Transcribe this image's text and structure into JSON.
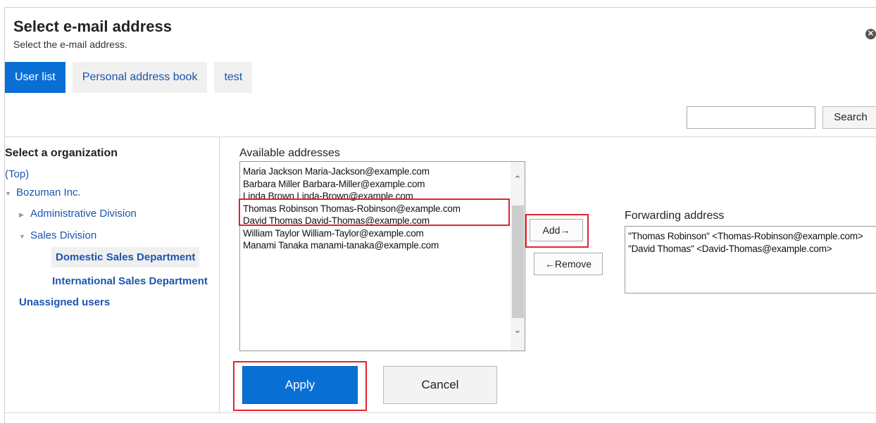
{
  "dialog": {
    "title": "Select e-mail address",
    "subtitle": "Select the e-mail address.",
    "close_icon": "close-icon"
  },
  "tabs": [
    {
      "label": "User list",
      "active": true
    },
    {
      "label": "Personal address book",
      "active": false
    },
    {
      "label": "test",
      "active": false
    }
  ],
  "search": {
    "value": "",
    "button_label": "Search"
  },
  "organization": {
    "heading": "Select a organization",
    "top": "(Top)",
    "root": "Bozuman Inc.",
    "admin": "Administrative Division",
    "sales": "Sales Division",
    "domestic": "Domestic Sales Department",
    "international": "International Sales Department",
    "unassigned": "Unassigned users"
  },
  "available": {
    "label": "Available addresses",
    "items": [
      "Maria Jackson Maria-Jackson@example.com",
      "Barbara Miller Barbara-Miller@example.com",
      "Linda Brown Linda-Brown@example.com",
      "Thomas Robinson Thomas-Robinson@example.com",
      "David Thomas David-Thomas@example.com",
      "William Taylor William-Taylor@example.com",
      "Manami Tanaka manami-tanaka@example.com"
    ]
  },
  "actions": {
    "add_label": "Add→",
    "remove_label": "←Remove"
  },
  "forwarding": {
    "label": "Forwarding address",
    "items": [
      "\"Thomas Robinson\" <Thomas-Robinson@example.com>",
      "\"David Thomas\" <David-Thomas@example.com>"
    ]
  },
  "footer": {
    "apply_label": "Apply",
    "cancel_label": "Cancel"
  },
  "colors": {
    "accent": "#0a6fd4",
    "link": "#1a55b0",
    "highlight": "#e0242f"
  }
}
